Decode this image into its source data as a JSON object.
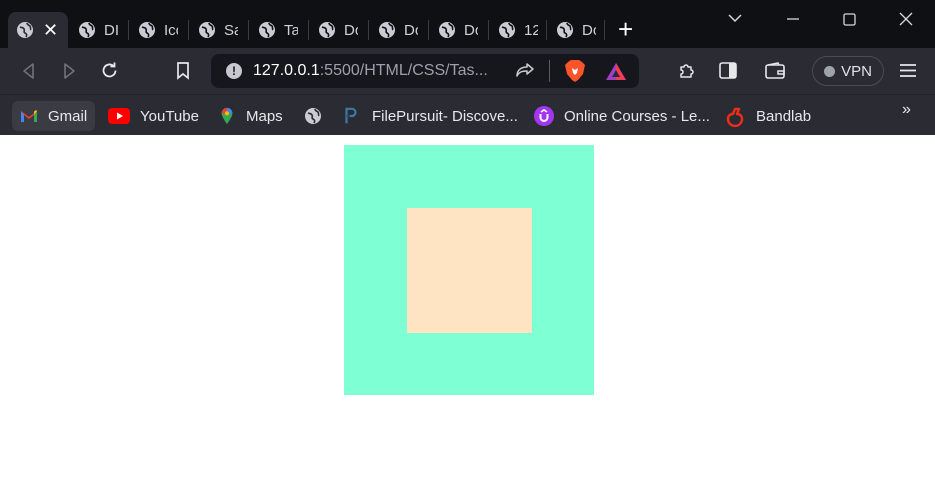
{
  "browser": {
    "tabs": [
      {
        "title": "DI",
        "active": true
      },
      {
        "title": "Ico",
        "active": false
      },
      {
        "title": "Sa",
        "active": false
      },
      {
        "title": "Ta",
        "active": false
      },
      {
        "title": "Do",
        "active": false
      },
      {
        "title": "Do",
        "active": false
      },
      {
        "title": "Do",
        "active": false
      },
      {
        "title": "12",
        "active": false
      },
      {
        "title": "Do",
        "active": false
      }
    ],
    "url_host": "127.0.0.1",
    "url_rest": ":5500/HTML/CSS/Tas...",
    "vpn_label": "VPN",
    "bookmarks": [
      {
        "label": "Gmail",
        "icon": "gmail-icon"
      },
      {
        "label": "YouTube",
        "icon": "youtube-icon"
      },
      {
        "label": "Maps",
        "icon": "maps-icon"
      },
      {
        "label": "",
        "icon": "globe-icon"
      },
      {
        "label": "FilePursuit- Discove...",
        "icon": "filepursuit-icon"
      },
      {
        "label": "Online Courses - Le...",
        "icon": "udemy-icon"
      },
      {
        "label": "Bandlab",
        "icon": "bandlab-icon"
      }
    ]
  },
  "page": {
    "outer_color": "#7fffd4",
    "inner_color": "#ffe4c4"
  }
}
